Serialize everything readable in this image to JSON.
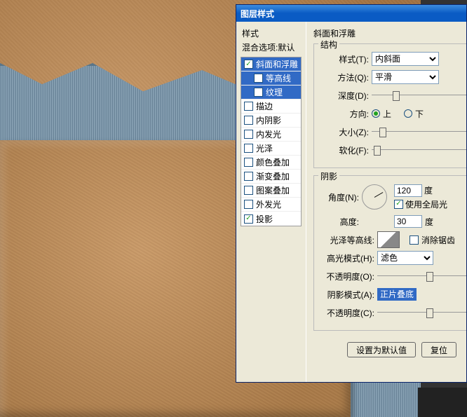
{
  "dialog": {
    "title": "图层样式",
    "left": {
      "header": "样式",
      "blend": "混合选项:默认",
      "items": [
        {
          "label": "斜面和浮雕",
          "checked": true,
          "selected": true,
          "indent": false
        },
        {
          "label": "等高线",
          "checked": false,
          "selected": true,
          "indent": true
        },
        {
          "label": "纹理",
          "checked": false,
          "selected": true,
          "indent": true
        },
        {
          "label": "描边",
          "checked": false,
          "selected": false,
          "indent": false
        },
        {
          "label": "内阴影",
          "checked": false,
          "selected": false,
          "indent": false
        },
        {
          "label": "内发光",
          "checked": false,
          "selected": false,
          "indent": false
        },
        {
          "label": "光泽",
          "checked": false,
          "selected": false,
          "indent": false
        },
        {
          "label": "颜色叠加",
          "checked": false,
          "selected": false,
          "indent": false
        },
        {
          "label": "渐变叠加",
          "checked": false,
          "selected": false,
          "indent": false
        },
        {
          "label": "图案叠加",
          "checked": false,
          "selected": false,
          "indent": false
        },
        {
          "label": "外发光",
          "checked": false,
          "selected": false,
          "indent": false
        },
        {
          "label": "投影",
          "checked": true,
          "selected": false,
          "indent": false
        }
      ]
    },
    "right": {
      "section_title": "斜面和浮雕",
      "struct_legend": "结构",
      "style_label": "样式(T):",
      "style_value": "内斜面",
      "method_label": "方法(Q):",
      "method_value": "平滑",
      "depth_label": "深度(D):",
      "direction_label": "方向:",
      "dir_up": "上",
      "dir_down": "下",
      "size_label": "大小(Z):",
      "soften_label": "软化(F):",
      "shadow_legend": "阴影",
      "angle_label": "角度(N):",
      "angle_value": "120",
      "degree": "度",
      "global_light": "使用全局光",
      "altitude_label": "高度:",
      "altitude_value": "30",
      "gloss_label": "光泽等高线:",
      "antialias": "消除锯齿",
      "highlight_mode_label": "高光模式(H):",
      "highlight_mode_value": "滤色",
      "opacity1_label": "不透明度(O):",
      "shadow_mode_label": "阴影模式(A):",
      "shadow_mode_value": "正片叠底",
      "opacity2_label": "不透明度(C):",
      "btn_default": "设置为默认值",
      "btn_reset": "复位"
    }
  }
}
